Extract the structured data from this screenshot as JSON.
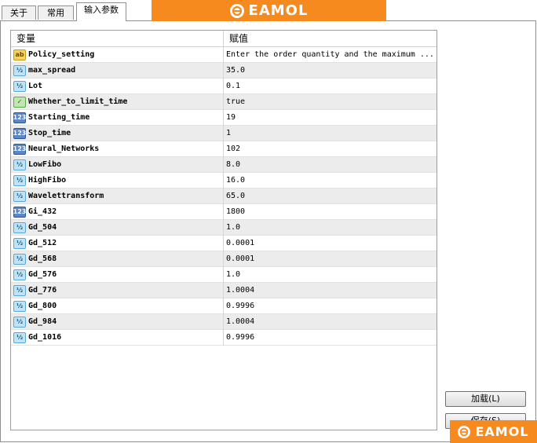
{
  "tabs": [
    {
      "label": "关于"
    },
    {
      "label": "常用"
    },
    {
      "label": "输入参数"
    }
  ],
  "brand": {
    "name": "EAMOL",
    "color": "#f78a1f"
  },
  "table": {
    "headers": [
      "变量",
      "赋值"
    ],
    "rows": [
      {
        "icon": "ab",
        "name": "Policy_setting",
        "value": "Enter the order quantity and the maximum ..."
      },
      {
        "icon": "v",
        "name": "max_spread",
        "value": "35.0"
      },
      {
        "icon": "v",
        "name": "Lot",
        "value": "0.1"
      },
      {
        "icon": "b",
        "name": "Whether_to_limit_time",
        "value": "true"
      },
      {
        "icon": "i",
        "name": "Starting_time",
        "value": "19"
      },
      {
        "icon": "i",
        "name": "Stop_time",
        "value": "1"
      },
      {
        "icon": "i",
        "name": "Neural_Networks",
        "value": "102"
      },
      {
        "icon": "v",
        "name": "LowFibo",
        "value": "8.0"
      },
      {
        "icon": "v",
        "name": "HighFibo",
        "value": "16.0"
      },
      {
        "icon": "v",
        "name": "Wavelettransform",
        "value": "65.0"
      },
      {
        "icon": "i",
        "name": "Gi_432",
        "value": "1800"
      },
      {
        "icon": "v",
        "name": "Gd_504",
        "value": "1.0"
      },
      {
        "icon": "v",
        "name": "Gd_512",
        "value": "0.0001"
      },
      {
        "icon": "v",
        "name": "Gd_568",
        "value": "0.0001"
      },
      {
        "icon": "v",
        "name": "Gd_576",
        "value": "1.0"
      },
      {
        "icon": "v",
        "name": "Gd_776",
        "value": "1.0004"
      },
      {
        "icon": "v",
        "name": "Gd_800",
        "value": "0.9996"
      },
      {
        "icon": "v",
        "name": "Gd_984",
        "value": "1.0004"
      },
      {
        "icon": "v",
        "name": "Gd_1016",
        "value": "0.9996"
      }
    ]
  },
  "buttons": {
    "load": "加载(L)",
    "save": "保存(S)"
  }
}
